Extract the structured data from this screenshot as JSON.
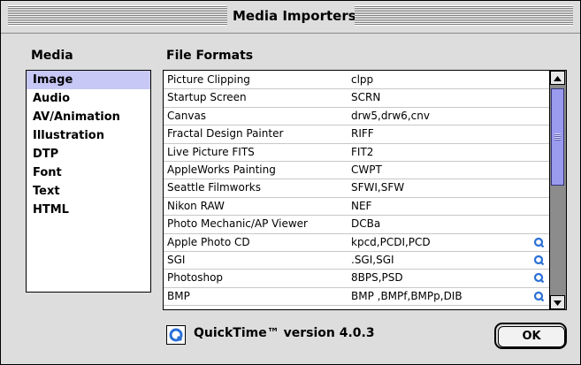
{
  "window": {
    "title": "Media Importers"
  },
  "media": {
    "header": "Media",
    "items": [
      {
        "label": "Image",
        "selected": true
      },
      {
        "label": "Audio",
        "selected": false
      },
      {
        "label": "AV/Animation",
        "selected": false
      },
      {
        "label": "Illustration",
        "selected": false
      },
      {
        "label": "DTP",
        "selected": false
      },
      {
        "label": "Font",
        "selected": false
      },
      {
        "label": "Text",
        "selected": false
      },
      {
        "label": "HTML",
        "selected": false
      }
    ]
  },
  "formats": {
    "header": "File Formats",
    "rows": [
      {
        "name": "Picture Clipping",
        "code": "clpp",
        "quicktime": false
      },
      {
        "name": "Startup Screen",
        "code": "SCRN",
        "quicktime": false
      },
      {
        "name": "Canvas",
        "code": "drw5,drw6,cnv",
        "quicktime": false
      },
      {
        "name": "Fractal Design Painter",
        "code": "RIFF",
        "quicktime": false
      },
      {
        "name": "Live Picture FITS",
        "code": "FIT2",
        "quicktime": false
      },
      {
        "name": "AppleWorks Painting",
        "code": "CWPT",
        "quicktime": false
      },
      {
        "name": "Seattle Filmworks",
        "code": "SFWI,SFW",
        "quicktime": false
      },
      {
        "name": "Nikon RAW",
        "code": "NEF",
        "quicktime": false
      },
      {
        "name": "Photo Mechanic/AP Viewer",
        "code": "DCBa",
        "quicktime": false
      },
      {
        "name": "Apple Photo CD",
        "code": "kpcd,PCDI,PCD",
        "quicktime": true
      },
      {
        "name": "SGI",
        "code": ".SGI,SGI",
        "quicktime": true
      },
      {
        "name": "Photoshop",
        "code": "8BPS,PSD",
        "quicktime": true
      },
      {
        "name": "BMP",
        "code": "BMP ,BMPf,BMPp,DIB",
        "quicktime": true
      }
    ]
  },
  "footer": {
    "version_text": "QuickTime™ version 4.0.3",
    "ok_label": "OK"
  },
  "colors": {
    "selection": "#c8c8f6",
    "scroll_thumb": "#9a9aee",
    "quicktime_blue": "#2a6fd6"
  }
}
